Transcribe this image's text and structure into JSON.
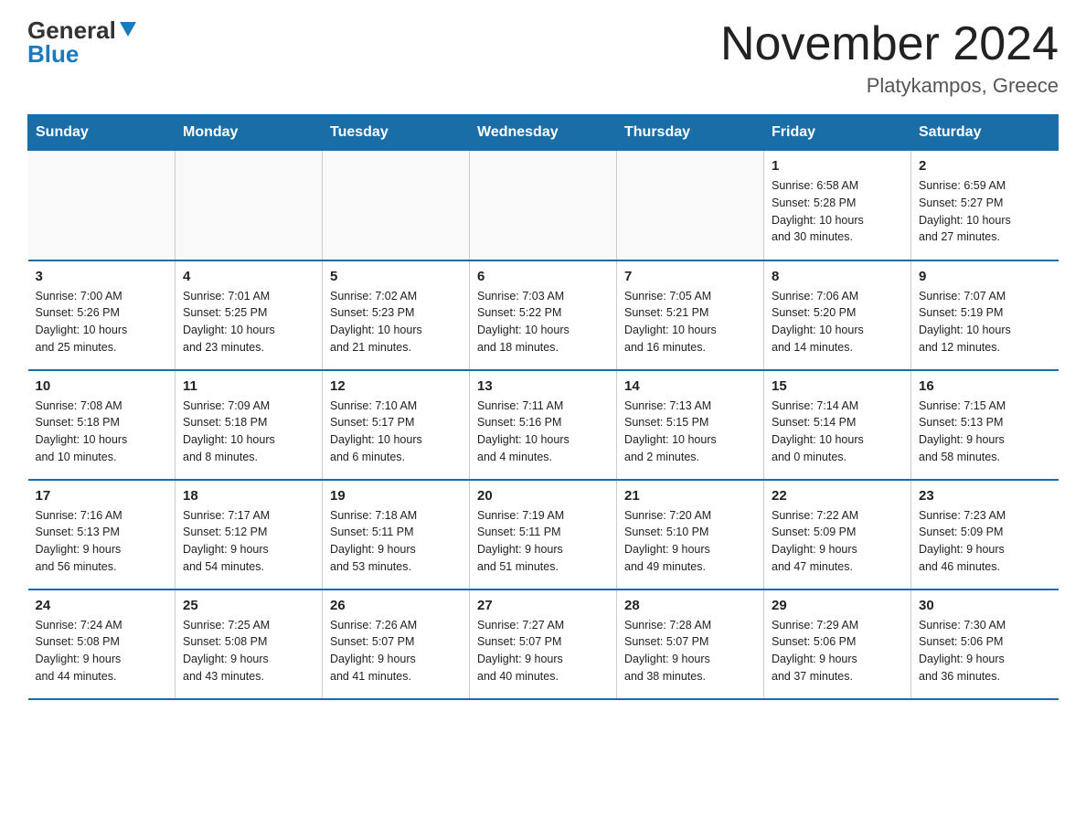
{
  "header": {
    "logo_general": "General",
    "logo_blue": "Blue",
    "month_title": "November 2024",
    "location": "Platykampos, Greece"
  },
  "days_of_week": [
    "Sunday",
    "Monday",
    "Tuesday",
    "Wednesday",
    "Thursday",
    "Friday",
    "Saturday"
  ],
  "weeks": [
    [
      {
        "num": "",
        "info": ""
      },
      {
        "num": "",
        "info": ""
      },
      {
        "num": "",
        "info": ""
      },
      {
        "num": "",
        "info": ""
      },
      {
        "num": "",
        "info": ""
      },
      {
        "num": "1",
        "info": "Sunrise: 6:58 AM\nSunset: 5:28 PM\nDaylight: 10 hours\nand 30 minutes."
      },
      {
        "num": "2",
        "info": "Sunrise: 6:59 AM\nSunset: 5:27 PM\nDaylight: 10 hours\nand 27 minutes."
      }
    ],
    [
      {
        "num": "3",
        "info": "Sunrise: 7:00 AM\nSunset: 5:26 PM\nDaylight: 10 hours\nand 25 minutes."
      },
      {
        "num": "4",
        "info": "Sunrise: 7:01 AM\nSunset: 5:25 PM\nDaylight: 10 hours\nand 23 minutes."
      },
      {
        "num": "5",
        "info": "Sunrise: 7:02 AM\nSunset: 5:23 PM\nDaylight: 10 hours\nand 21 minutes."
      },
      {
        "num": "6",
        "info": "Sunrise: 7:03 AM\nSunset: 5:22 PM\nDaylight: 10 hours\nand 18 minutes."
      },
      {
        "num": "7",
        "info": "Sunrise: 7:05 AM\nSunset: 5:21 PM\nDaylight: 10 hours\nand 16 minutes."
      },
      {
        "num": "8",
        "info": "Sunrise: 7:06 AM\nSunset: 5:20 PM\nDaylight: 10 hours\nand 14 minutes."
      },
      {
        "num": "9",
        "info": "Sunrise: 7:07 AM\nSunset: 5:19 PM\nDaylight: 10 hours\nand 12 minutes."
      }
    ],
    [
      {
        "num": "10",
        "info": "Sunrise: 7:08 AM\nSunset: 5:18 PM\nDaylight: 10 hours\nand 10 minutes."
      },
      {
        "num": "11",
        "info": "Sunrise: 7:09 AM\nSunset: 5:18 PM\nDaylight: 10 hours\nand 8 minutes."
      },
      {
        "num": "12",
        "info": "Sunrise: 7:10 AM\nSunset: 5:17 PM\nDaylight: 10 hours\nand 6 minutes."
      },
      {
        "num": "13",
        "info": "Sunrise: 7:11 AM\nSunset: 5:16 PM\nDaylight: 10 hours\nand 4 minutes."
      },
      {
        "num": "14",
        "info": "Sunrise: 7:13 AM\nSunset: 5:15 PM\nDaylight: 10 hours\nand 2 minutes."
      },
      {
        "num": "15",
        "info": "Sunrise: 7:14 AM\nSunset: 5:14 PM\nDaylight: 10 hours\nand 0 minutes."
      },
      {
        "num": "16",
        "info": "Sunrise: 7:15 AM\nSunset: 5:13 PM\nDaylight: 9 hours\nand 58 minutes."
      }
    ],
    [
      {
        "num": "17",
        "info": "Sunrise: 7:16 AM\nSunset: 5:13 PM\nDaylight: 9 hours\nand 56 minutes."
      },
      {
        "num": "18",
        "info": "Sunrise: 7:17 AM\nSunset: 5:12 PM\nDaylight: 9 hours\nand 54 minutes."
      },
      {
        "num": "19",
        "info": "Sunrise: 7:18 AM\nSunset: 5:11 PM\nDaylight: 9 hours\nand 53 minutes."
      },
      {
        "num": "20",
        "info": "Sunrise: 7:19 AM\nSunset: 5:11 PM\nDaylight: 9 hours\nand 51 minutes."
      },
      {
        "num": "21",
        "info": "Sunrise: 7:20 AM\nSunset: 5:10 PM\nDaylight: 9 hours\nand 49 minutes."
      },
      {
        "num": "22",
        "info": "Sunrise: 7:22 AM\nSunset: 5:09 PM\nDaylight: 9 hours\nand 47 minutes."
      },
      {
        "num": "23",
        "info": "Sunrise: 7:23 AM\nSunset: 5:09 PM\nDaylight: 9 hours\nand 46 minutes."
      }
    ],
    [
      {
        "num": "24",
        "info": "Sunrise: 7:24 AM\nSunset: 5:08 PM\nDaylight: 9 hours\nand 44 minutes."
      },
      {
        "num": "25",
        "info": "Sunrise: 7:25 AM\nSunset: 5:08 PM\nDaylight: 9 hours\nand 43 minutes."
      },
      {
        "num": "26",
        "info": "Sunrise: 7:26 AM\nSunset: 5:07 PM\nDaylight: 9 hours\nand 41 minutes."
      },
      {
        "num": "27",
        "info": "Sunrise: 7:27 AM\nSunset: 5:07 PM\nDaylight: 9 hours\nand 40 minutes."
      },
      {
        "num": "28",
        "info": "Sunrise: 7:28 AM\nSunset: 5:07 PM\nDaylight: 9 hours\nand 38 minutes."
      },
      {
        "num": "29",
        "info": "Sunrise: 7:29 AM\nSunset: 5:06 PM\nDaylight: 9 hours\nand 37 minutes."
      },
      {
        "num": "30",
        "info": "Sunrise: 7:30 AM\nSunset: 5:06 PM\nDaylight: 9 hours\nand 36 minutes."
      }
    ]
  ]
}
